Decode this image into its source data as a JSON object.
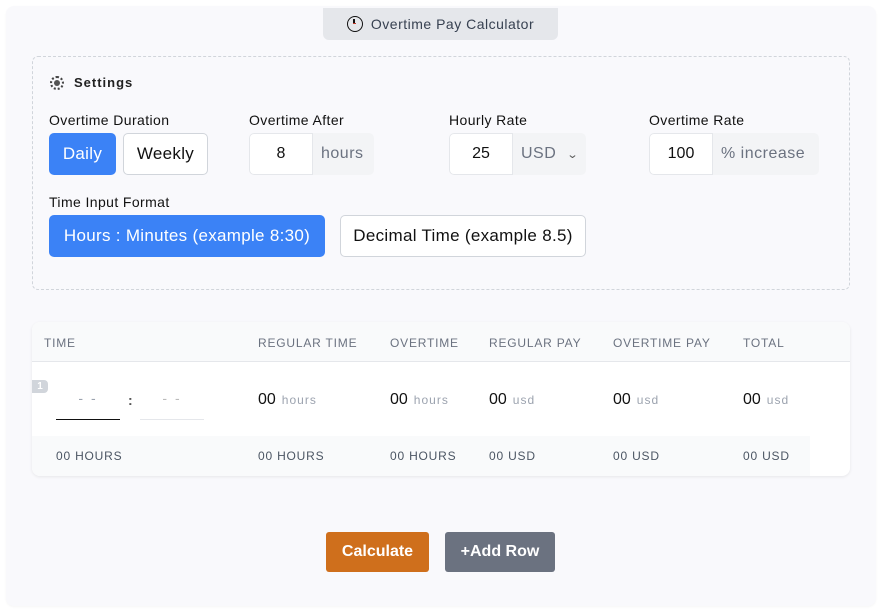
{
  "header": {
    "title": "Overtime Pay Calculator",
    "icon": "clock-icon"
  },
  "settings": {
    "title": "Settings",
    "icon": "gear-icon",
    "overtime_duration": {
      "label": "Overtime Duration",
      "options": [
        "Daily",
        "Weekly"
      ],
      "selected": "Daily"
    },
    "overtime_after": {
      "label": "Overtime After",
      "value": "8",
      "unit": "hours"
    },
    "hourly_rate": {
      "label": "Hourly Rate",
      "value": "25",
      "currency": "USD"
    },
    "overtime_rate": {
      "label": "Overtime Rate",
      "value": "100",
      "unit": "% increase"
    },
    "time_input_format": {
      "label": "Time Input Format",
      "options": [
        "Hours : Minutes (example 8:30)",
        "Decimal Time (example 8.5)"
      ],
      "selected": "Hours : Minutes (example 8:30)"
    }
  },
  "table": {
    "headers": [
      "TIME",
      "REGULAR TIME",
      "OVERTIME",
      "REGULAR PAY",
      "OVERTIME PAY",
      "TOTAL"
    ],
    "rows": [
      {
        "number": "1",
        "hours_placeholder": "- -",
        "minutes_placeholder": "- -",
        "separator": ":",
        "regular_time": {
          "value": "00",
          "unit": "hours"
        },
        "overtime": {
          "value": "00",
          "unit": "hours"
        },
        "regular_pay": {
          "value": "00",
          "unit": "usd"
        },
        "overtime_pay": {
          "value": "00",
          "unit": "usd"
        },
        "total": {
          "value": "00",
          "unit": "usd"
        }
      }
    ],
    "totals": [
      "00 HOURS",
      "00 HOURS",
      "00 HOURS",
      "00 USD",
      "00 USD",
      "00 USD"
    ]
  },
  "actions": {
    "calculate": "Calculate",
    "add_row": "+Add Row"
  },
  "colors": {
    "primary": "#3b82f6",
    "calculate": "#cf6f1c",
    "add_row": "#6b7280"
  }
}
